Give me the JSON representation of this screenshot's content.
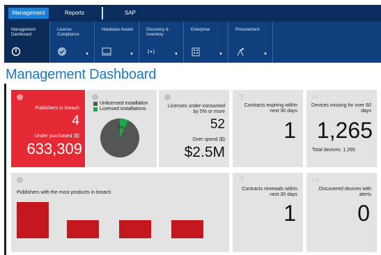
{
  "top_tabs": [
    {
      "label": "Management",
      "active": true
    },
    {
      "label": "Reports",
      "active": false
    },
    {
      "label": "SAP",
      "active": false
    }
  ],
  "sub_nav": [
    {
      "label": "Management Dashboard",
      "icon": "power-icon",
      "active": true
    },
    {
      "label": "License Compliance",
      "icon": "check-badge-icon",
      "active": false
    },
    {
      "label": "Hardware Assets",
      "icon": "monitor-icon",
      "active": false
    },
    {
      "label": "Discovery & Inventory",
      "icon": "wireless-icon",
      "active": false
    },
    {
      "label": "Enterprise",
      "icon": "building-icon",
      "active": false
    },
    {
      "label": "Procurement",
      "icon": "plant-icon",
      "active": false
    }
  ],
  "page_title": "Management Dashboard",
  "tiles": {
    "breach": {
      "label": "Publishers in breach",
      "count": "4",
      "under_label": "Under purchased ($)",
      "under_value": "633,309"
    },
    "installations": {
      "legend_unlicensed": "Unlicensed installation",
      "legend_licensed": "Licensed installations",
      "pct_label": "7%",
      "licensed_fraction": 0.07,
      "color_unlicensed": "#555555",
      "color_licensed": "#1fa84a"
    },
    "underconsumed": {
      "label": "Licenses under-consumed by 5% or more",
      "count": "52",
      "spend_label": "Over spend ($)",
      "spend_value": "$2.5M"
    },
    "expiring": {
      "label": "Contracts expiring within next 30 days",
      "count": "1"
    },
    "missing": {
      "label": "Devices missing for over 60 days",
      "count": "1,265",
      "total": "Total devices: 1,265"
    },
    "publishers_products": {
      "label": "Publishers with the most products in breach",
      "bar_values": [
        4,
        2,
        2,
        2
      ],
      "bar_color": "#c4161f"
    },
    "renewals": {
      "label": "Contracts renewals within next 30 days",
      "count": "1"
    },
    "alerts": {
      "label": "Discovered devices with alerts",
      "count": "0"
    }
  }
}
